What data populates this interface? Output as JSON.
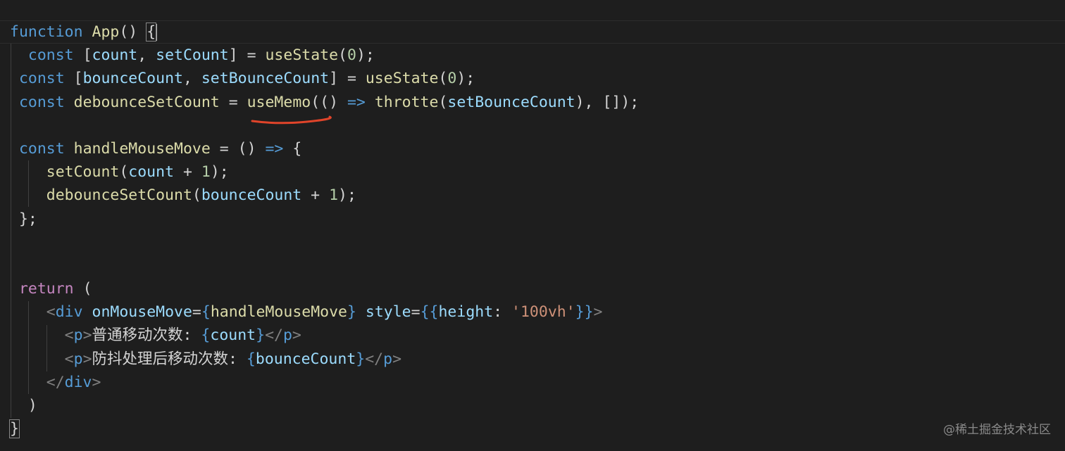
{
  "editor": {
    "lines": [
      [
        {
          "t": "function",
          "c": "kw"
        },
        {
          "t": " "
        },
        {
          "t": "App",
          "c": "fn"
        },
        {
          "t": "() "
        },
        {
          "t": "{",
          "c": "punc",
          "box": true
        }
      ],
      [
        {
          "t": "  "
        },
        {
          "t": "const",
          "c": "kw"
        },
        {
          "t": " ["
        },
        {
          "t": "count",
          "c": "var"
        },
        {
          "t": ", "
        },
        {
          "t": "setCount",
          "c": "var"
        },
        {
          "t": "] = "
        },
        {
          "t": "useState",
          "c": "fn"
        },
        {
          "t": "("
        },
        {
          "t": "0",
          "c": "num"
        },
        {
          "t": ");"
        }
      ],
      [
        {
          "t": " "
        },
        {
          "t": "const",
          "c": "kw"
        },
        {
          "t": " ["
        },
        {
          "t": "bounceCount",
          "c": "var"
        },
        {
          "t": ", "
        },
        {
          "t": "setBounceCount",
          "c": "var"
        },
        {
          "t": "] = "
        },
        {
          "t": "useState",
          "c": "fn"
        },
        {
          "t": "("
        },
        {
          "t": "0",
          "c": "num"
        },
        {
          "t": ");"
        }
      ],
      [
        {
          "t": " "
        },
        {
          "t": "const",
          "c": "kw"
        },
        {
          "t": " "
        },
        {
          "t": "debounceSetCount",
          "c": "fn"
        },
        {
          "t": " = "
        },
        {
          "t": "useMemo",
          "c": "fn"
        },
        {
          "t": "(() "
        },
        {
          "t": "=>",
          "c": "kw"
        },
        {
          "t": " "
        },
        {
          "t": "throtte",
          "c": "fn"
        },
        {
          "t": "("
        },
        {
          "t": "setBounceCount",
          "c": "var"
        },
        {
          "t": "), []);"
        }
      ],
      [],
      [
        {
          "t": " "
        },
        {
          "t": "const",
          "c": "kw"
        },
        {
          "t": " "
        },
        {
          "t": "handleMouseMove",
          "c": "fn"
        },
        {
          "t": " = () "
        },
        {
          "t": "=>",
          "c": "kw"
        },
        {
          "t": " {"
        }
      ],
      [
        {
          "t": "    "
        },
        {
          "t": "setCount",
          "c": "fn"
        },
        {
          "t": "("
        },
        {
          "t": "count",
          "c": "var"
        },
        {
          "t": " + "
        },
        {
          "t": "1",
          "c": "num"
        },
        {
          "t": ");"
        }
      ],
      [
        {
          "t": "    "
        },
        {
          "t": "debounceSetCount",
          "c": "fn"
        },
        {
          "t": "("
        },
        {
          "t": "bounceCount",
          "c": "var"
        },
        {
          "t": " + "
        },
        {
          "t": "1",
          "c": "num"
        },
        {
          "t": ");"
        }
      ],
      [
        {
          "t": " };"
        }
      ],
      [],
      [],
      [
        {
          "t": " "
        },
        {
          "t": "return",
          "c": "ctrl"
        },
        {
          "t": " ("
        }
      ],
      [
        {
          "t": "    "
        },
        {
          "t": "<",
          "c": "tagp"
        },
        {
          "t": "div",
          "c": "tag"
        },
        {
          "t": " "
        },
        {
          "t": "onMouseMove",
          "c": "attr"
        },
        {
          "t": "="
        },
        {
          "t": "{",
          "c": "kw"
        },
        {
          "t": "handleMouseMove",
          "c": "fn"
        },
        {
          "t": "}",
          "c": "kw"
        },
        {
          "t": " "
        },
        {
          "t": "style",
          "c": "attr"
        },
        {
          "t": "="
        },
        {
          "t": "{{",
          "c": "kw"
        },
        {
          "t": "height",
          "c": "var"
        },
        {
          "t": ": "
        },
        {
          "t": "'100vh'",
          "c": "str"
        },
        {
          "t": "}}",
          "c": "kw"
        },
        {
          "t": ">",
          "c": "tagp"
        }
      ],
      [
        {
          "t": "      "
        },
        {
          "t": "<",
          "c": "tagp"
        },
        {
          "t": "p",
          "c": "tag"
        },
        {
          "t": ">",
          "c": "tagp"
        },
        {
          "t": "普通移动次数: "
        },
        {
          "t": "{",
          "c": "kw"
        },
        {
          "t": "count",
          "c": "var"
        },
        {
          "t": "}",
          "c": "kw"
        },
        {
          "t": "</",
          "c": "tagp"
        },
        {
          "t": "p",
          "c": "tag"
        },
        {
          "t": ">",
          "c": "tagp"
        }
      ],
      [
        {
          "t": "      "
        },
        {
          "t": "<",
          "c": "tagp"
        },
        {
          "t": "p",
          "c": "tag"
        },
        {
          "t": ">",
          "c": "tagp"
        },
        {
          "t": "防抖处理后移动次数: "
        },
        {
          "t": "{",
          "c": "kw"
        },
        {
          "t": "bounceCount",
          "c": "var"
        },
        {
          "t": "}",
          "c": "kw"
        },
        {
          "t": "</",
          "c": "tagp"
        },
        {
          "t": "p",
          "c": "tag"
        },
        {
          "t": ">",
          "c": "tagp"
        }
      ],
      [
        {
          "t": "    "
        },
        {
          "t": "</",
          "c": "tagp"
        },
        {
          "t": "div",
          "c": "tag"
        },
        {
          "t": ">",
          "c": "tagp"
        }
      ],
      [
        {
          "t": "  )"
        }
      ],
      [
        {
          "t": "}",
          "box": true
        }
      ]
    ]
  },
  "colors": {
    "background": "#1e1e1e",
    "keyword": "#569cd6",
    "function": "#dcdcaa",
    "variable": "#9cdcfe",
    "number": "#b5cea8",
    "string": "#ce9178",
    "control": "#c586c0",
    "annotation": "#e0442a"
  },
  "annotation": {
    "icon": "red-underline-mark",
    "target": "useMemo"
  },
  "watermark": {
    "text": "@稀土掘金技术社区"
  }
}
